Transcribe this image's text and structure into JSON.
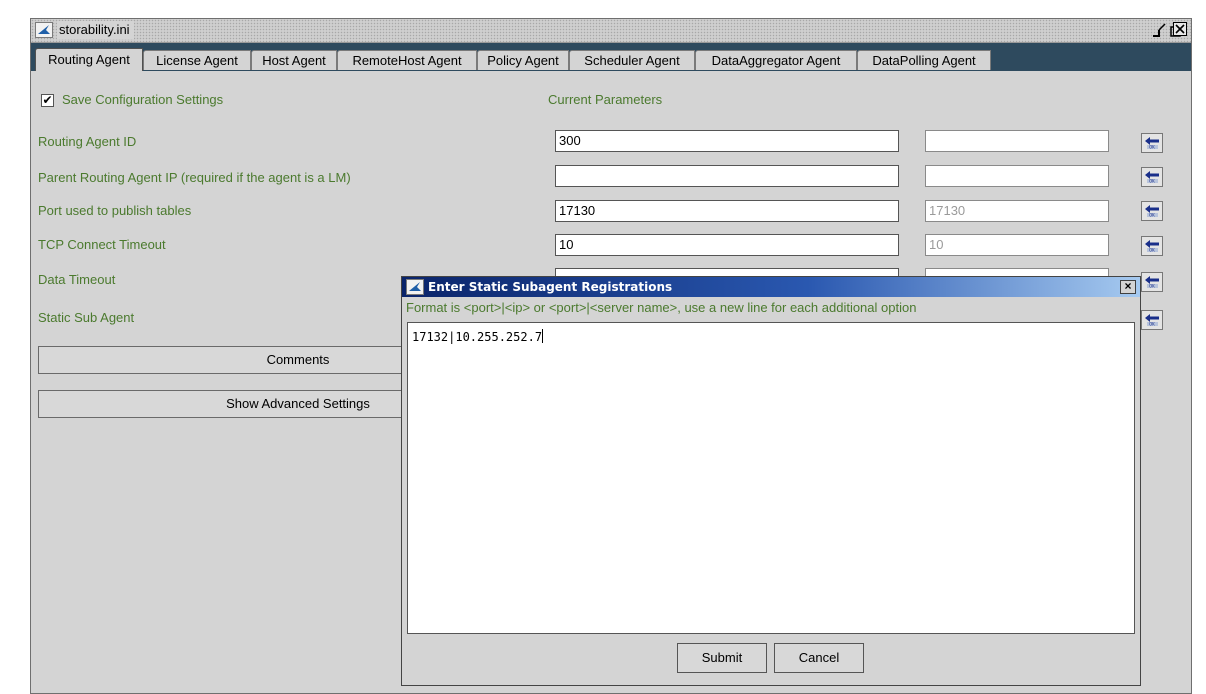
{
  "window": {
    "title": "storability.ini"
  },
  "tabs": [
    {
      "label": "Routing Agent"
    },
    {
      "label": "License Agent"
    },
    {
      "label": "Host Agent"
    },
    {
      "label": "RemoteHost Agent"
    },
    {
      "label": "Policy Agent"
    },
    {
      "label": "Scheduler Agent"
    },
    {
      "label": "DataAggregator Agent"
    },
    {
      "label": "DataPolling Agent"
    }
  ],
  "form": {
    "save_config": {
      "label": "Save Configuration Settings",
      "checked": true,
      "mark": "✔"
    },
    "current_params_label": "Current Parameters",
    "rows": [
      {
        "label": "Routing Agent ID",
        "value": "300",
        "current": ""
      },
      {
        "label": "Parent Routing Agent IP (required if the agent is a LM)",
        "value": "",
        "current": ""
      },
      {
        "label": "Port used to publish tables",
        "value": "17130",
        "current": "17130"
      },
      {
        "label": "TCP Connect Timeout",
        "value": "10",
        "current": "10"
      },
      {
        "label": "Data Timeout",
        "value": "",
        "current": ""
      },
      {
        "label": "Static Sub Agent"
      }
    ],
    "comments_button": "Comments",
    "advanced_button": "Show Advanced Settings"
  },
  "dialog": {
    "title": "Enter Static Subagent Registrations",
    "close_glyph": "×",
    "hint": "Format is <port>|<ip> or <port>|<server name>, use a new line for each additional option",
    "text": "17132|10.255.252.7",
    "submit_label": "Submit",
    "cancel_label": "Cancel"
  },
  "colors": {
    "label_green": "#4b7a2e",
    "tab_bar": "#2e4a5e",
    "dialog_title_start": "#0a246a",
    "dialog_title_end": "#a6caf0"
  },
  "icons": {
    "app": "app-arrow-icon",
    "apply": "ok-arrow-icon",
    "minimize": "minimize-icon",
    "maximize": "maximize-icon",
    "close": "close-icon"
  }
}
